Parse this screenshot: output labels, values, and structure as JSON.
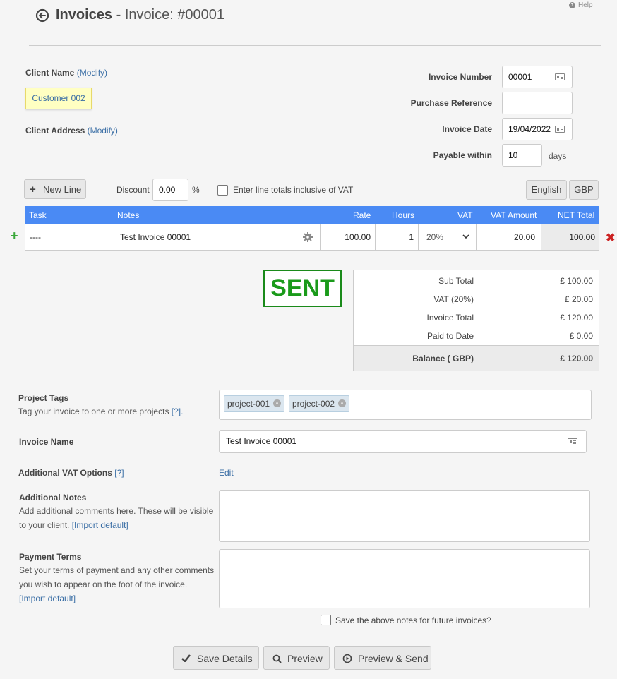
{
  "header": {
    "title": "Invoices",
    "subtitle": "Invoice: #00001",
    "help_label": "Help"
  },
  "client": {
    "name_label": "Client Name",
    "name_modify": "(Modify)",
    "customer": "Customer 002",
    "address_label": "Client Address",
    "address_modify": "(Modify)"
  },
  "invoice": {
    "number_label": "Invoice Number",
    "number_value": "00001",
    "purchase_ref_label": "Purchase Reference",
    "purchase_ref_value": "",
    "date_label": "Invoice Date",
    "date_value": "19/04/2022",
    "payable_label": "Payable within",
    "payable_value": "10",
    "payable_unit": "days"
  },
  "toolbar": {
    "new_line_label": "New Line",
    "discount_label": "Discount",
    "discount_value": "0.00",
    "discount_unit": "%",
    "inclusive_vat_label": "Enter line totals inclusive of VAT",
    "language_button": "English",
    "currency_button": "GBP"
  },
  "table": {
    "headers": [
      "Task",
      "Notes",
      "Rate",
      "Hours",
      "VAT",
      "VAT Amount",
      "NET Total"
    ],
    "rows": [
      {
        "task": "----",
        "notes": "Test Invoice 00001",
        "rate": "100.00",
        "hours": "1",
        "vat": "20%",
        "vat_amount": "20.00",
        "net_total": "100.00"
      }
    ]
  },
  "status_stamp": "SENT",
  "totals": {
    "sub_total_label": "Sub Total",
    "sub_total_value": "£ 100.00",
    "vat_label": "VAT (20%)",
    "vat_value": "£ 20.00",
    "invoice_total_label": "Invoice Total",
    "invoice_total_value": "£ 120.00",
    "paid_label": "Paid to Date",
    "paid_value": "£ 0.00",
    "balance_label": "Balance ( GBP)",
    "balance_value": "£ 120.00"
  },
  "project_tags": {
    "label": "Project Tags",
    "desc": "Tag your invoice to one or more projects",
    "help_link": "[?].",
    "tags": [
      "project-001",
      "project-002"
    ]
  },
  "invoice_name": {
    "label": "Invoice Name",
    "value": "Test Invoice 00001"
  },
  "vat_options": {
    "label": "Additional VAT Options",
    "help_link": "[?]",
    "edit_link": "Edit"
  },
  "notes": {
    "label": "Additional Notes",
    "desc_line1": "Add additional comments here. These will be visible",
    "desc_line2": "to your client.",
    "import_link": "[Import default]"
  },
  "payment_terms": {
    "label": "Payment Terms",
    "desc_line1": "Set your terms of payment and any other comments",
    "desc_line2": "you wish to appear on the foot of the invoice.",
    "import_link": "[Import default]"
  },
  "save_notes_label": "Save the above notes for future invoices?",
  "actions": {
    "save": "Save Details",
    "preview": "Preview",
    "preview_send": "Preview & Send"
  },
  "colors": {
    "table_header": "#4a8af4",
    "sent": "#1a9a1a",
    "link": "#3a6ea5",
    "delete": "#cc2222",
    "add": "#3aa83a"
  }
}
